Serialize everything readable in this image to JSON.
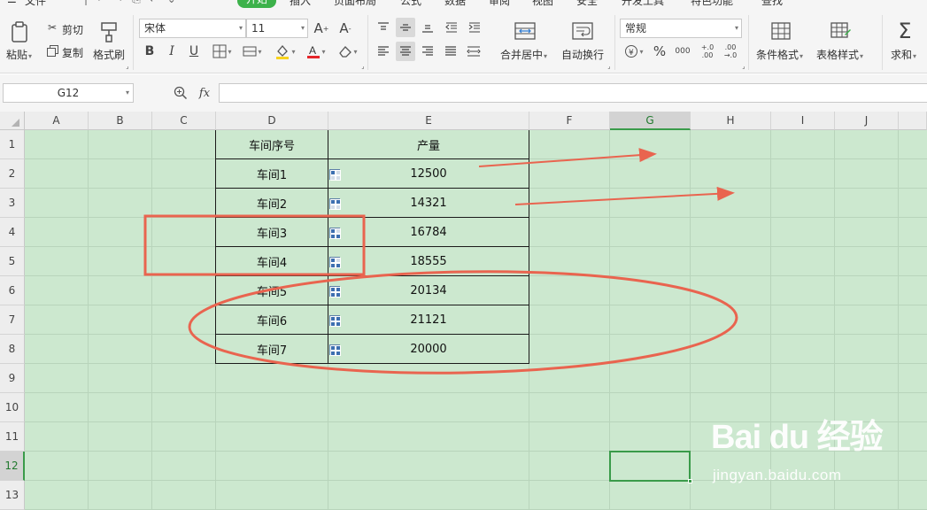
{
  "menu_tabs": [
    "文件",
    "开始",
    "插入",
    "页面布局",
    "公式",
    "数据",
    "审阅",
    "视图",
    "安全",
    "开发工具",
    "特色功能",
    "查找"
  ],
  "active_tab": "开始",
  "ribbon": {
    "paste": "粘贴",
    "cut": "剪切",
    "copy": "复制",
    "format_painter": "格式刷",
    "font_name": "宋体",
    "font_size": "11",
    "merge_center": "合并居中",
    "wrap_text": "自动换行",
    "number_format": "常规",
    "conditional_format": "条件格式",
    "table_style": "表格样式",
    "sum": "求和",
    "percent": "%",
    "thousands": "000",
    "dec_inc": "+.0 .00",
    "dec_dec": ".00 →.0"
  },
  "formula_bar": {
    "name_box": "G12",
    "fx": "fx",
    "formula": ""
  },
  "columns": [
    "A",
    "B",
    "C",
    "D",
    "E",
    "F",
    "G",
    "H",
    "I",
    "J"
  ],
  "selected_column": "G",
  "rows": [
    "1",
    "2",
    "3",
    "4",
    "5",
    "6",
    "7",
    "8",
    "9",
    "10",
    "11",
    "12",
    "13"
  ],
  "selected_row": "12",
  "table": {
    "header": [
      "车间序号",
      "产量"
    ],
    "rows": [
      {
        "name": "车间1",
        "value": "12500"
      },
      {
        "name": "车间2",
        "value": "14321"
      },
      {
        "name": "车间3",
        "value": "16784"
      },
      {
        "name": "车间4",
        "value": "18555"
      },
      {
        "name": "车间5",
        "value": "20134"
      },
      {
        "name": "车间6",
        "value": "21121"
      },
      {
        "name": "车间7",
        "value": "20000"
      }
    ]
  },
  "annotation_color": "#e9644f",
  "watermark": {
    "main": "Bai du 经验",
    "url": "jingyan.baidu.com"
  }
}
